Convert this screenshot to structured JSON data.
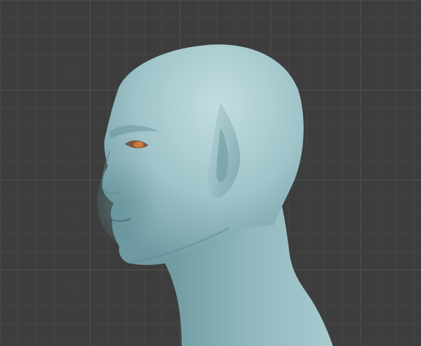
{
  "viewport": {
    "background_color": "#3d3d3d",
    "grid_minor_color": "#474747",
    "grid_major_color": "#525252",
    "grid_visible": true
  },
  "model": {
    "subject": "elf-head-bust",
    "skin_color": "#9fc4c9",
    "skin_shadow_color": "#5e8c93",
    "skin_highlight_color": "#c3dde0",
    "eye_color": "#d07a3c"
  }
}
